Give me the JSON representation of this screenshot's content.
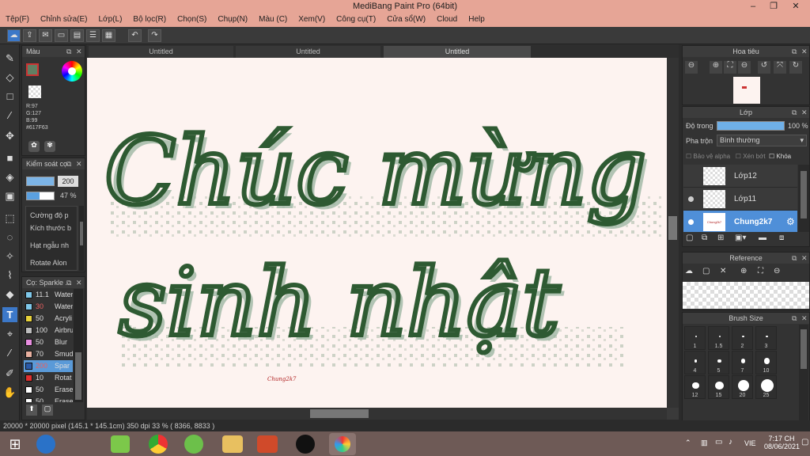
{
  "app": {
    "title": "MediBang Paint Pro (64bit)"
  },
  "window_buttons": [
    "–",
    "❐",
    "✕"
  ],
  "menu": [
    "Tệp(F)",
    "Chỉnh sửa(E)",
    "Lớp(L)",
    "Bộ lọc(R)",
    "Chọn(S)",
    "Chụp(N)",
    "Màu (C)",
    "Xem(V)",
    "Công cụ(T)",
    "Cửa sổ(W)",
    "Cloud",
    "Help"
  ],
  "tabs": [
    "Untitled",
    "Untitled",
    "Untitled"
  ],
  "color_panel": {
    "title": "Màu",
    "primary": "#617F63",
    "r": "R:97",
    "g": "G:127",
    "b": "B:99",
    "hex": "#617F63"
  },
  "brush_control": {
    "title": "Kiểm soát cọ",
    "size": "200",
    "opacity": "47 %",
    "rows": [
      "Cường độ p",
      "Kích thước b",
      "Hạt ngẫu nh",
      "Rotate Alon"
    ]
  },
  "brush_list": {
    "title": "Cọ: Sparkle ...",
    "items": [
      {
        "size": "11.1",
        "name": "Water",
        "color": "#7fc8ea"
      },
      {
        "size": "30",
        "name": "Water",
        "color": "#7fc8ea"
      },
      {
        "size": "50",
        "name": "Acryli",
        "color": "#e8d23a"
      },
      {
        "size": "100",
        "name": "Airbru",
        "color": "#bdbdbd"
      },
      {
        "size": "50",
        "name": "Blur",
        "color": "#e88ee0"
      },
      {
        "size": "70",
        "name": "Smud",
        "color": "#e8b0a0"
      },
      {
        "size": "200",
        "name": "Spar",
        "color": "#2a5aa8"
      },
      {
        "size": "10",
        "name": "Rotat",
        "color": "#e03030"
      },
      {
        "size": "50",
        "name": "Erase",
        "color": "#ffffff"
      },
      {
        "size": "50",
        "name": "Erase",
        "color": "#ffffff"
      }
    ]
  },
  "navigator": {
    "title": "Hoa tiêu"
  },
  "layers": {
    "title": "Lớp",
    "opacity_label": "Độ trong",
    "opacity_value": "100 %",
    "opacity": 1.0,
    "blend_label": "Pha trộn",
    "blend_value": "Bình thường",
    "protect_alpha": "Bảo vệ alpha",
    "clipping": "Xén bớt",
    "lock": "Khóa",
    "items": [
      {
        "name": "Lớp12"
      },
      {
        "name": "Lớp11"
      },
      {
        "name": "Chung2k7",
        "thumb_text": "Chung2k7"
      }
    ]
  },
  "reference": {
    "title": "Reference"
  },
  "brush_size": {
    "title": "Brush Size",
    "labels": [
      "1",
      "1.5",
      "2",
      "3",
      "4",
      "5",
      "7",
      "10",
      "12",
      "15",
      "20",
      "25"
    ]
  },
  "canvas": {
    "line1": "Chúc mừng",
    "line2": "sinh nhật",
    "signature": "Chung2k7",
    "ink": "#2e5a32",
    "shadow": "#9fb8a4"
  },
  "status": {
    "text": "20000 * 20000 pixel   (145.1 * 145.1cm)   350 dpi   33 %   ( 8366, 8833 )"
  },
  "taskbar": {
    "lang": "VIE",
    "time": "7:17 CH",
    "date": "08/06/2021"
  }
}
